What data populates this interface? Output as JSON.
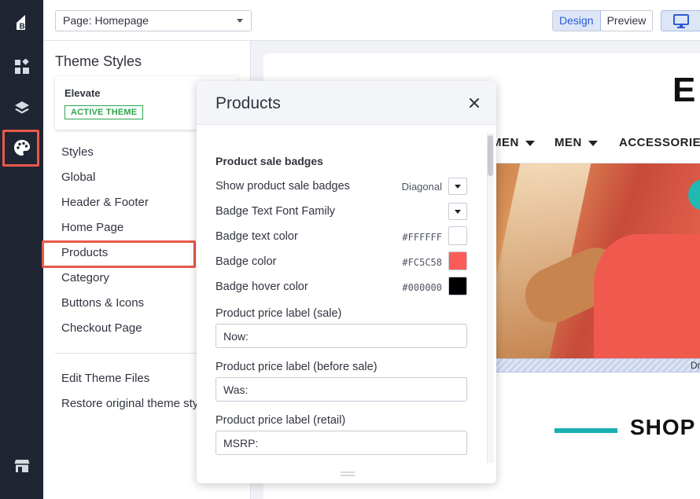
{
  "rail": {
    "icons": [
      "bigcommerce-logo-icon",
      "dashboard-widgets-icon",
      "layers-icon",
      "theme-palette-icon",
      "storefront-icon"
    ]
  },
  "topbar": {
    "page_select_value": "Page: Homepage",
    "mode_design": "Design",
    "mode_preview": "Preview",
    "device_icon": "desktop-monitor-icon"
  },
  "sidebar": {
    "title": "Theme Styles",
    "theme_name": "Elevate",
    "theme_badge": "ACTIVE THEME",
    "items": [
      {
        "label": "Styles"
      },
      {
        "label": "Global"
      },
      {
        "label": "Header & Footer"
      },
      {
        "label": "Home Page"
      },
      {
        "label": "Products"
      },
      {
        "label": "Category"
      },
      {
        "label": "Buttons & Icons"
      },
      {
        "label": "Checkout Page"
      }
    ],
    "footer_items": [
      {
        "label": "Edit Theme Files"
      },
      {
        "label": "Restore original theme styles"
      }
    ]
  },
  "modal": {
    "title": "Products",
    "section_title": "Product sale badges",
    "rows": [
      {
        "label": "Show product sale badges",
        "value": "Diagonal"
      },
      {
        "label": "Badge Text Font Family",
        "value": ""
      },
      {
        "label": "Badge text color",
        "value": "#FFFFFF",
        "color": "#FFFFFF"
      },
      {
        "label": "Badge color",
        "value": "#FC5C58",
        "color": "#FC5C58"
      },
      {
        "label": "Badge hover color",
        "value": "#000000",
        "color": "#000000"
      }
    ],
    "fields": [
      {
        "label": "Product price label (sale)",
        "value": "Now:"
      },
      {
        "label": "Product price label (before sale)",
        "value": "Was:"
      },
      {
        "label": "Product price label (retail)",
        "value": "MSRP:"
      }
    ]
  },
  "preview": {
    "logo": "E",
    "nav": [
      "MEN",
      "MEN",
      "ACCESSORIES"
    ],
    "hatch_label": "Dr",
    "shop_heading": "SHOP"
  },
  "colors": {
    "rail_bg": "#1f2532",
    "highlight": "#e8584a",
    "accent_blue": "#2c5bd6",
    "active_green": "#2ea44f",
    "brand_teal": "#17b0b1"
  }
}
